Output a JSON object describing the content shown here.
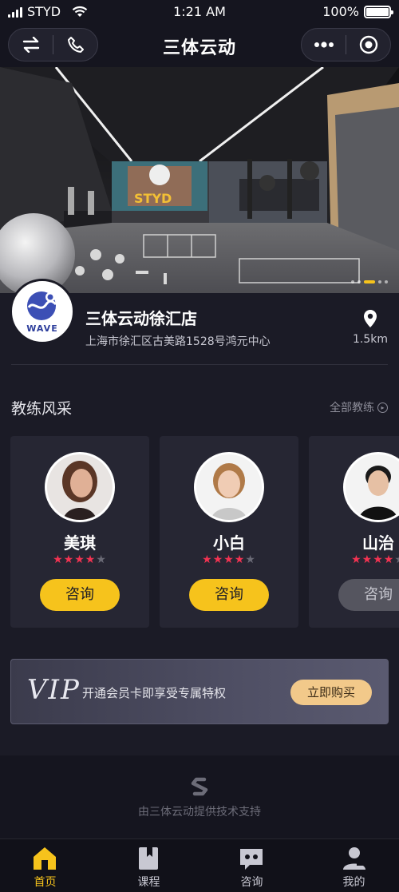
{
  "status_bar": {
    "carrier": "STYD",
    "time": "1:21 AM",
    "battery": "100%",
    "icons": [
      "signal-icon",
      "wifi-icon",
      "battery-icon"
    ]
  },
  "nav": {
    "title": "三体云动",
    "left_icons": [
      "switch-arrows-icon",
      "phone-icon"
    ],
    "right_icons": [
      "more-dots-icon",
      "target-circle-icon"
    ]
  },
  "hero": {
    "wall_mural_text": "STYD",
    "carousel_index": 3,
    "carousel_count": 5
  },
  "store": {
    "logo_text": "WAVE",
    "name": "三体云动徐汇店",
    "address": "上海市徐汇区古美路1528号鸿元中心",
    "distance": "1.5km"
  },
  "coaches_section": {
    "title": "教练风采",
    "more_label": "全部教练",
    "coaches": [
      {
        "name": "美琪",
        "rating": 4,
        "max_rating": 5,
        "button": "咨询",
        "button_enabled": true
      },
      {
        "name": "小白",
        "rating": 4,
        "max_rating": 5,
        "button": "咨询",
        "button_enabled": true
      },
      {
        "name": "山治",
        "rating": 4,
        "max_rating": 5,
        "button": "咨询",
        "button_enabled": false
      }
    ]
  },
  "vip": {
    "mark": "VIP",
    "text": "开通会员卡即享受专属特权",
    "button": "立即购买"
  },
  "footer": {
    "text": "由三体云动提供技术支持"
  },
  "tab_bar": {
    "tabs": [
      {
        "label": "首页",
        "icon": "home-icon",
        "active": true
      },
      {
        "label": "课程",
        "icon": "book-icon",
        "active": false
      },
      {
        "label": "咨询",
        "icon": "chat-icon",
        "active": false
      },
      {
        "label": "我的",
        "icon": "user-icon",
        "active": false
      }
    ]
  },
  "colors": {
    "accent": "#f6c31c",
    "star": "#f23352",
    "background": "#1b1b26"
  }
}
